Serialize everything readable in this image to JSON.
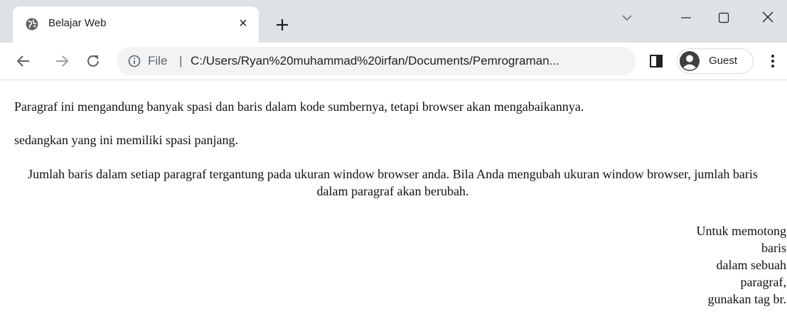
{
  "browser": {
    "tab": {
      "title": "Belajar Web",
      "close": "×"
    },
    "new_tab": "+",
    "address_bar": {
      "scheme": "File",
      "separator": "|",
      "url": "C:/Users/Ryan%20muhammad%20irfan/Documents/Pemrograman..."
    },
    "profile": {
      "label": "Guest"
    }
  },
  "page": {
    "paragraph_1": "Paragraf ini mengandung banyak spasi dan baris dalam kode sumbernya, tetapi browser akan mengabaikannya.",
    "paragraph_2": "sedangkan yang ini memiliki spasi panjang.",
    "paragraph_3": "Jumlah baris dalam setiap paragraf tergantung pada ukuran window browser anda. Bila Anda mengubah ukuran window browser, jumlah baris dalam paragraf akan berubah.",
    "paragraph_4_lines": [
      "Untuk memotong",
      "baris",
      "dalam sebuah",
      "paragraf,",
      "gunakan tag br."
    ]
  },
  "icons": {
    "tab_favicon": "globe-icon",
    "back": "arrow-left-icon",
    "forward": "arrow-right-icon",
    "reload": "reload-icon",
    "info": "info-icon",
    "side_panel": "side-panel-icon",
    "avatar": "avatar-icon",
    "menu": "kebab-menu-icon"
  }
}
